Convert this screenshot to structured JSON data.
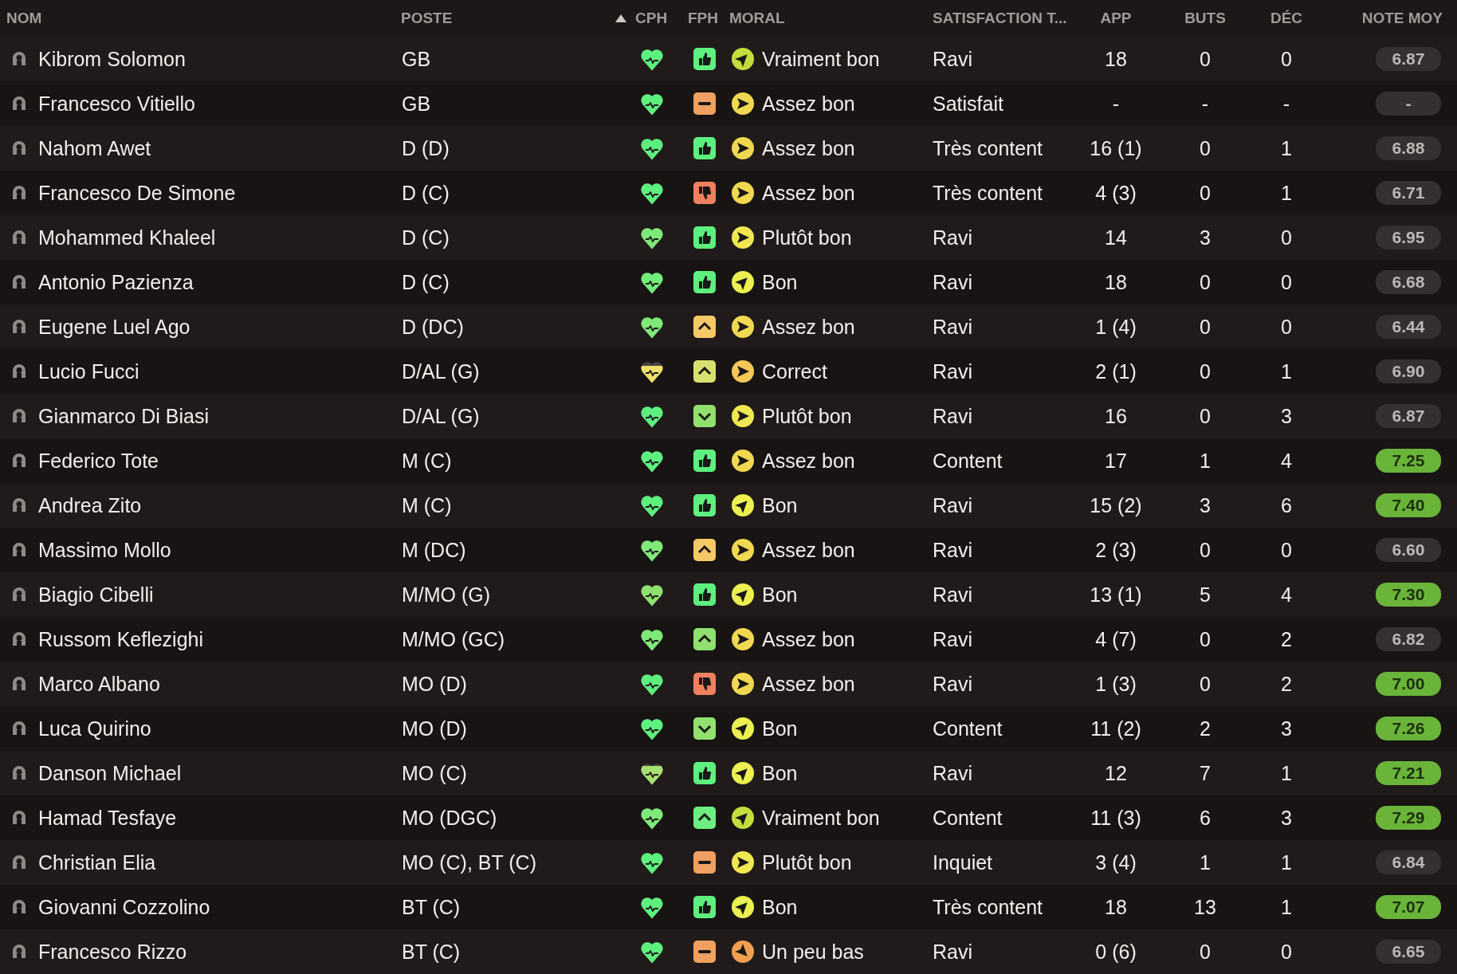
{
  "columns": [
    {
      "label": "NOM",
      "sorted": false
    },
    {
      "label": "POSTE",
      "sorted": true
    },
    {
      "label": "CPH",
      "sorted": false
    },
    {
      "label": "FPH",
      "sorted": false
    },
    {
      "label": "MORAL",
      "sorted": false
    },
    {
      "label": "SATISFACTION T...",
      "sorted": false
    },
    {
      "label": "APP",
      "sorted": false
    },
    {
      "label": "BUTS",
      "sorted": false
    },
    {
      "label": "DÉC",
      "sorted": false
    },
    {
      "label": "NOTE MOY",
      "sorted": false
    }
  ],
  "rows": [
    {
      "name": "Kibrom Solomon",
      "position": "GB",
      "cph": {
        "level": 1,
        "color": "#5ef07f"
      },
      "fph": {
        "kind": "thumbs_up",
        "color": "#5ef07f"
      },
      "morale": {
        "text": "Vraiment bon",
        "kind": "up",
        "color": "#c4dc3c"
      },
      "satisfaction": "Ravi",
      "apps": "18",
      "goals": "0",
      "assists": "0",
      "rating": {
        "text": "6.87",
        "good": false
      }
    },
    {
      "name": "Francesco Vitiello",
      "position": "GB",
      "cph": {
        "level": 1,
        "color": "#5ef07f"
      },
      "fph": {
        "kind": "neutral",
        "color": "#f0a060"
      },
      "morale": {
        "text": "Assez bon",
        "kind": "right",
        "color": "#f0d850"
      },
      "satisfaction": "Satisfait",
      "apps": "-",
      "goals": "-",
      "assists": "-",
      "rating": {
        "text": "-",
        "good": false
      }
    },
    {
      "name": "Nahom Awet",
      "position": "D (D)",
      "cph": {
        "level": 1,
        "color": "#5ef07f"
      },
      "fph": {
        "kind": "thumbs_up",
        "color": "#5ef07f"
      },
      "morale": {
        "text": "Assez bon",
        "kind": "right",
        "color": "#f0d850"
      },
      "satisfaction": "Très content",
      "apps": "16 (1)",
      "goals": "0",
      "assists": "1",
      "rating": {
        "text": "6.88",
        "good": false
      }
    },
    {
      "name": "Francesco De Simone",
      "position": "D (C)",
      "cph": {
        "level": 1,
        "color": "#5ef07f"
      },
      "fph": {
        "kind": "thumbs_down",
        "color": "#ee8060"
      },
      "morale": {
        "text": "Assez bon",
        "kind": "right",
        "color": "#f0d850"
      },
      "satisfaction": "Très content",
      "apps": "4 (3)",
      "goals": "0",
      "assists": "1",
      "rating": {
        "text": "6.71",
        "good": false
      }
    },
    {
      "name": "Mohammed Khaleel",
      "position": "D (C)",
      "cph": {
        "level": 1,
        "color": "#7ee878"
      },
      "fph": {
        "kind": "thumbs_up",
        "color": "#5ef07f"
      },
      "morale": {
        "text": "Plutôt bon",
        "kind": "right",
        "color": "#f0e850"
      },
      "satisfaction": "Ravi",
      "apps": "14",
      "goals": "3",
      "assists": "0",
      "rating": {
        "text": "6.95",
        "good": false
      }
    },
    {
      "name": "Antonio Pazienza",
      "position": "D (C)",
      "cph": {
        "level": 1,
        "color": "#72ec7a"
      },
      "fph": {
        "kind": "thumbs_up",
        "color": "#5ef07f"
      },
      "morale": {
        "text": "Bon",
        "kind": "up",
        "color": "#ecf050"
      },
      "satisfaction": "Ravi",
      "apps": "18",
      "goals": "0",
      "assists": "0",
      "rating": {
        "text": "6.68",
        "good": false
      }
    },
    {
      "name": "Eugene Luel Ago",
      "position": "D (DC)",
      "cph": {
        "level": 1,
        "color": "#7ee878"
      },
      "fph": {
        "kind": "up",
        "color": "#f5c868"
      },
      "morale": {
        "text": "Assez bon",
        "kind": "right",
        "color": "#f0d850"
      },
      "satisfaction": "Ravi",
      "apps": "1 (4)",
      "goals": "0",
      "assists": "0",
      "rating": {
        "text": "6.44",
        "good": false
      }
    },
    {
      "name": "Lucio Fucci",
      "position": "D/AL (G)",
      "cph": {
        "level": 0.75,
        "color": "#ece068"
      },
      "fph": {
        "kind": "up",
        "color": "#d8e070"
      },
      "morale": {
        "text": "Correct",
        "kind": "right",
        "color": "#f5c858"
      },
      "satisfaction": "Ravi",
      "apps": "2 (1)",
      "goals": "0",
      "assists": "1",
      "rating": {
        "text": "6.90",
        "good": false
      }
    },
    {
      "name": "Gianmarco Di Biasi",
      "position": "D/AL (G)",
      "cph": {
        "level": 1,
        "color": "#5ef07f"
      },
      "fph": {
        "kind": "down",
        "color": "#92e070"
      },
      "morale": {
        "text": "Plutôt bon",
        "kind": "right",
        "color": "#f0e850"
      },
      "satisfaction": "Ravi",
      "apps": "16",
      "goals": "0",
      "assists": "3",
      "rating": {
        "text": "6.87",
        "good": false
      }
    },
    {
      "name": "Federico Tote",
      "position": "M (C)",
      "cph": {
        "level": 1,
        "color": "#5ef07f"
      },
      "fph": {
        "kind": "thumbs_up",
        "color": "#5ef07f"
      },
      "morale": {
        "text": "Assez bon",
        "kind": "right",
        "color": "#f0d850"
      },
      "satisfaction": "Content",
      "apps": "17",
      "goals": "1",
      "assists": "4",
      "rating": {
        "text": "7.25",
        "good": true
      }
    },
    {
      "name": "Andrea Zito",
      "position": "M (C)",
      "cph": {
        "level": 1,
        "color": "#5ef07f"
      },
      "fph": {
        "kind": "thumbs_up",
        "color": "#5ef07f"
      },
      "morale": {
        "text": "Bon",
        "kind": "up",
        "color": "#ecf050"
      },
      "satisfaction": "Ravi",
      "apps": "15 (2)",
      "goals": "3",
      "assists": "6",
      "rating": {
        "text": "7.40",
        "good": true
      }
    },
    {
      "name": "Massimo Mollo",
      "position": "M (DC)",
      "cph": {
        "level": 1,
        "color": "#7ee878"
      },
      "fph": {
        "kind": "up",
        "color": "#f5c868"
      },
      "morale": {
        "text": "Assez bon",
        "kind": "right",
        "color": "#f0d850"
      },
      "satisfaction": "Ravi",
      "apps": "2 (3)",
      "goals": "0",
      "assists": "0",
      "rating": {
        "text": "6.60",
        "good": false
      }
    },
    {
      "name": "Biagio Cibelli",
      "position": "M/MO (G)",
      "cph": {
        "level": 1,
        "color": "#8ee070"
      },
      "fph": {
        "kind": "thumbs_up",
        "color": "#5ef07f"
      },
      "morale": {
        "text": "Bon",
        "kind": "up",
        "color": "#ecf050"
      },
      "satisfaction": "Ravi",
      "apps": "13 (1)",
      "goals": "5",
      "assists": "4",
      "rating": {
        "text": "7.30",
        "good": true
      }
    },
    {
      "name": "Russom Keflezighi",
      "position": "M/MO (GC)",
      "cph": {
        "level": 1,
        "color": "#7ee878"
      },
      "fph": {
        "kind": "up",
        "color": "#8ee070"
      },
      "morale": {
        "text": "Assez bon",
        "kind": "right",
        "color": "#f0d850"
      },
      "satisfaction": "Ravi",
      "apps": "4 (7)",
      "goals": "0",
      "assists": "2",
      "rating": {
        "text": "6.82",
        "good": false
      }
    },
    {
      "name": "Marco Albano",
      "position": "MO (D)",
      "cph": {
        "level": 1,
        "color": "#5ef07f"
      },
      "fph": {
        "kind": "thumbs_down",
        "color": "#ee8060"
      },
      "morale": {
        "text": "Assez bon",
        "kind": "right",
        "color": "#f0d850"
      },
      "satisfaction": "Ravi",
      "apps": "1 (3)",
      "goals": "0",
      "assists": "2",
      "rating": {
        "text": "7.00",
        "good": true
      }
    },
    {
      "name": "Luca Quirino",
      "position": "MO (D)",
      "cph": {
        "level": 1,
        "color": "#5ef07f"
      },
      "fph": {
        "kind": "down",
        "color": "#92e070"
      },
      "morale": {
        "text": "Bon",
        "kind": "up",
        "color": "#ecf050"
      },
      "satisfaction": "Content",
      "apps": "11 (2)",
      "goals": "2",
      "assists": "3",
      "rating": {
        "text": "7.26",
        "good": true
      }
    },
    {
      "name": "Danson Michael",
      "position": "MO (C)",
      "cph": {
        "level": 0.8,
        "color": "#a8e070"
      },
      "fph": {
        "kind": "thumbs_up",
        "color": "#5ef07f"
      },
      "morale": {
        "text": "Bon",
        "kind": "up",
        "color": "#ecf050"
      },
      "satisfaction": "Ravi",
      "apps": "12",
      "goals": "7",
      "assists": "1",
      "rating": {
        "text": "7.21",
        "good": true
      }
    },
    {
      "name": "Hamad Tesfaye",
      "position": "MO (DGC)",
      "cph": {
        "level": 1,
        "color": "#7ee878"
      },
      "fph": {
        "kind": "up",
        "color": "#6eee80"
      },
      "morale": {
        "text": "Vraiment bon",
        "kind": "up",
        "color": "#c4dc3c"
      },
      "satisfaction": "Content",
      "apps": "11 (3)",
      "goals": "6",
      "assists": "3",
      "rating": {
        "text": "7.29",
        "good": true
      }
    },
    {
      "name": "Christian Elia",
      "position": "MO (C), BT (C)",
      "cph": {
        "level": 1,
        "color": "#5ef07f"
      },
      "fph": {
        "kind": "neutral",
        "color": "#f0a060"
      },
      "morale": {
        "text": "Plutôt bon",
        "kind": "right",
        "color": "#f0e850"
      },
      "satisfaction": "Inquiet",
      "apps": "3 (4)",
      "goals": "1",
      "assists": "1",
      "rating": {
        "text": "6.84",
        "good": false
      }
    },
    {
      "name": "Giovanni Cozzolino",
      "position": "BT (C)",
      "cph": {
        "level": 1,
        "color": "#5ef07f"
      },
      "fph": {
        "kind": "thumbs_up",
        "color": "#5ef07f"
      },
      "morale": {
        "text": "Bon",
        "kind": "up",
        "color": "#ecf050"
      },
      "satisfaction": "Très content",
      "apps": "18",
      "goals": "13",
      "assists": "1",
      "rating": {
        "text": "7.07",
        "good": true
      }
    },
    {
      "name": "Francesco Rizzo",
      "position": "BT (C)",
      "cph": {
        "level": 1,
        "color": "#5ef07f"
      },
      "fph": {
        "kind": "neutral",
        "color": "#f0a060"
      },
      "morale": {
        "text": "Un peu bas",
        "kind": "down",
        "color": "#f0a050"
      },
      "satisfaction": "Ravi",
      "apps": "0 (6)",
      "goals": "0",
      "assists": "0",
      "rating": {
        "text": "6.65",
        "good": false
      }
    }
  ]
}
